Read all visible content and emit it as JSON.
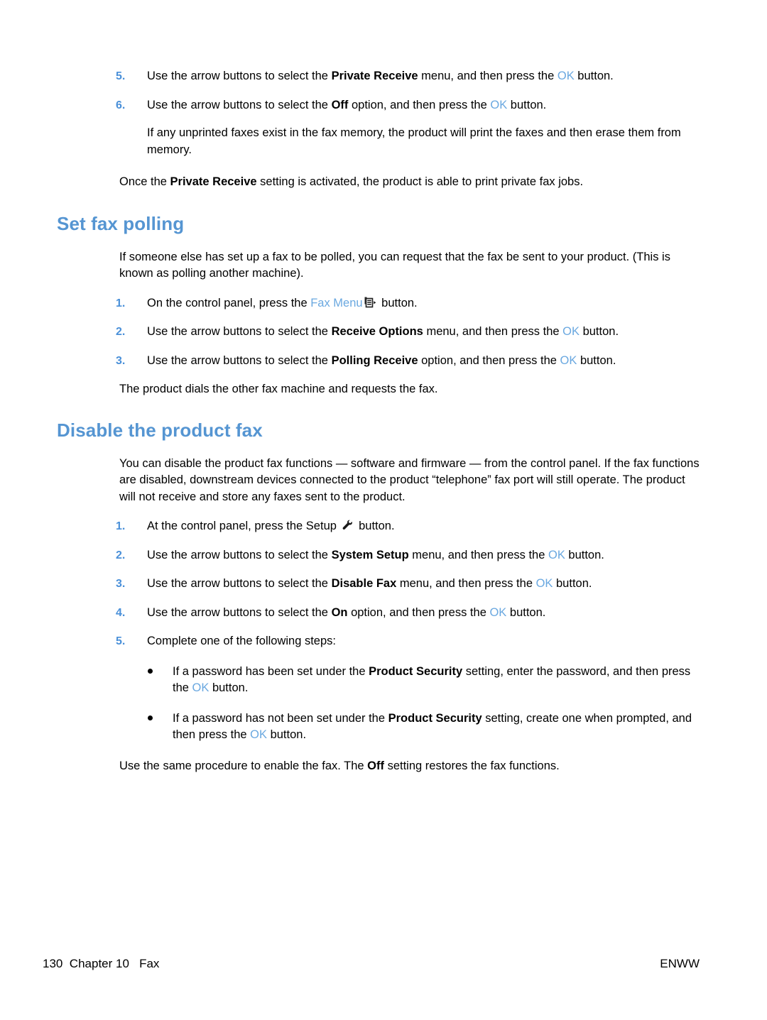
{
  "page": {
    "footer_left": "130  Chapter 10   Fax",
    "footer_right": "ENWW"
  },
  "top_section": {
    "steps": [
      {
        "num": "5.",
        "t1": "Use the arrow buttons to select the ",
        "bold": "Private Receive",
        "t2": " menu, and then press the ",
        "ok": "OK",
        "t3": " button."
      },
      {
        "num": "6.",
        "t1": "Use the arrow buttons to select the ",
        "bold": "Off",
        "t2": " option, and then press the ",
        "ok": "OK",
        "t3": " button."
      }
    ],
    "note": "If any unprinted faxes exist in the fax memory, the product will print the faxes and then erase them from memory.",
    "closing": {
      "t1": "Once the ",
      "bold": "Private Receive",
      "t2": " setting is activated, the product is able to print private fax jobs."
    }
  },
  "set_fax_polling": {
    "heading": "Set fax polling",
    "intro": "If someone else has set up a fax to be polled, you can request that the fax be sent to your product. (This is known as polling another machine).",
    "steps": [
      {
        "num": "1.",
        "t1": "On the control panel, press the ",
        "menu": "Fax Menu",
        "icon": "fax-menu-icon",
        "t3": " button."
      },
      {
        "num": "2.",
        "t1": "Use the arrow buttons to select the ",
        "bold": "Receive Options",
        "t2": " menu, and then press the ",
        "ok": "OK",
        "t3": " button."
      },
      {
        "num": "3.",
        "t1": "Use the arrow buttons to select the ",
        "bold": "Polling Receive",
        "t2": " option, and then press the ",
        "ok": "OK",
        "t3": " button."
      }
    ],
    "closing": "The product dials the other fax machine and requests the fax."
  },
  "disable_product_fax": {
    "heading": "Disable the product fax",
    "intro": "You can disable the product fax functions — software and firmware — from the control panel. If the fax functions are disabled, downstream devices connected to the product “telephone” fax port will still operate. The product will not receive and store any faxes sent to the product.",
    "steps": [
      {
        "num": "1.",
        "t1": "At the control panel, press the Setup ",
        "icon": "wrench-icon",
        "t3": " button."
      },
      {
        "num": "2.",
        "t1": "Use the arrow buttons to select the ",
        "bold": "System Setup",
        "t2": " menu, and then press the ",
        "ok": "OK",
        "t3": " button."
      },
      {
        "num": "3.",
        "t1": "Use the arrow buttons to select the ",
        "bold": "Disable Fax",
        "t2": " menu, and then press the ",
        "ok": "OK",
        "t3": " button."
      },
      {
        "num": "4.",
        "t1": "Use the arrow buttons to select the ",
        "bold": "On",
        "t2": " option, and then press the ",
        "ok": "OK",
        "t3": " button."
      },
      {
        "num": "5.",
        "t1": "Complete one of the following steps:"
      }
    ],
    "bullets": [
      {
        "t1": "If a password has been set under the ",
        "bold": "Product Security",
        "t2": " setting, enter the password, and then press the ",
        "ok": "OK",
        "t3": " button."
      },
      {
        "t1": "If a password has not been set under the ",
        "bold": "Product Security",
        "t2": " setting, create one when prompted, and then press the ",
        "ok": "OK",
        "t3": " button."
      }
    ],
    "closing": {
      "t1": "Use the same procedure to enable the fax. The ",
      "bold": "Off",
      "t2": " setting restores the fax functions."
    }
  },
  "colors": {
    "heading_blue": "#5595d2",
    "step_number_blue": "#4a90d9",
    "ok_blue": "#6aa8e0"
  }
}
